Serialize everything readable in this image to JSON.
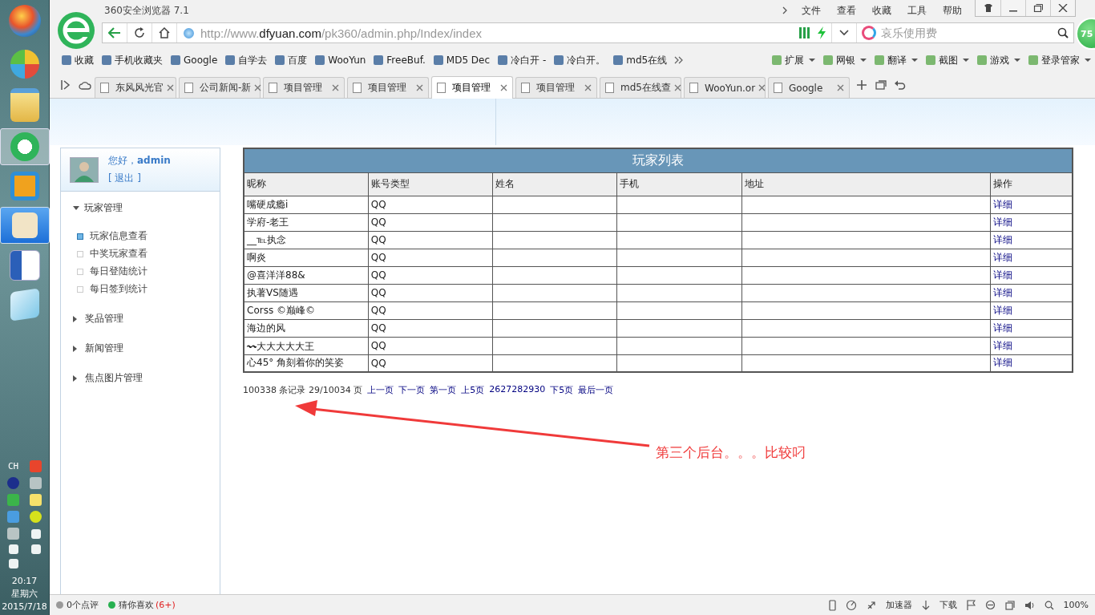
{
  "taskbar": {
    "input_method": "CH",
    "clock": {
      "time": "20:17",
      "weekday": "星期六",
      "date": "2015/7/18"
    }
  },
  "window": {
    "title": "360安全浏览器 7.1",
    "menu": [
      "文件",
      "查看",
      "收藏",
      "工具",
      "帮助"
    ],
    "speed_badge": "75"
  },
  "address_bar": {
    "url_prefix": "http://www.",
    "url_domain": "dfyuan.com",
    "url_path": "/pk360/admin.php/Index/index",
    "search_placeholder": "哀乐使用费"
  },
  "bookmarks": [
    "收藏",
    "手机收藏夹",
    "Google",
    "自学去",
    "百度",
    "WooYun",
    "FreeBuf.",
    "MD5 Dec",
    "冷白开 -",
    "冷白开。",
    "md5在线"
  ],
  "toolbar_right": [
    "扩展",
    "网银",
    "翻译",
    "截图",
    "游戏",
    "登录管家"
  ],
  "tabs": [
    {
      "label": "东风风光官",
      "selected": false
    },
    {
      "label": "公司新闻-新",
      "selected": false
    },
    {
      "label": "项目管理",
      "selected": false
    },
    {
      "label": "项目管理",
      "selected": false
    },
    {
      "label": "项目管理",
      "selected": true
    },
    {
      "label": "项目管理",
      "selected": false
    },
    {
      "label": "md5在线查",
      "selected": false
    },
    {
      "label": "WooYun.or",
      "selected": false
    },
    {
      "label": "Google",
      "selected": false
    }
  ],
  "sidebar": {
    "greeting": "您好，**admin**",
    "logout": "[ 退出 ]",
    "groups": [
      {
        "label": "玩家管理",
        "expanded": true,
        "children": [
          {
            "label": "玩家信息查看",
            "selected": true
          },
          {
            "label": "中奖玩家查看",
            "selected": false
          },
          {
            "label": "每日登陆统计",
            "selected": false
          },
          {
            "label": "每日签到统计",
            "selected": false
          }
        ]
      },
      {
        "label": "奖品管理",
        "expanded": false
      },
      {
        "label": "新闻管理",
        "expanded": false
      },
      {
        "label": "焦点图片管理",
        "expanded": false
      }
    ]
  },
  "table": {
    "title": "玩家列表",
    "columns": [
      "昵称",
      "账号类型",
      "姓名",
      "手机",
      "地址",
      "操作"
    ],
    "rows": [
      {
        "nickname": "嘴硬成瘾i",
        "account_type": "QQ",
        "action": "详细"
      },
      {
        "nickname": "学府-老王",
        "account_type": "QQ",
        "action": "详细"
      },
      {
        "nickname": "__℡执念",
        "account_type": "QQ",
        "action": "详细"
      },
      {
        "nickname": "啊炎",
        "account_type": "QQ",
        "action": "详细"
      },
      {
        "nickname": "@喜洋洋88&",
        "account_type": "QQ",
        "action": "详细"
      },
      {
        "nickname": "执著VS随遇",
        "account_type": "QQ",
        "action": "详细"
      },
      {
        "nickname": "Corss ©巅峰©",
        "account_type": "QQ",
        "action": "详细"
      },
      {
        "nickname": "海边的风",
        "account_type": "QQ",
        "action": "详细"
      },
      {
        "nickname": "〰大大大大大王",
        "account_type": "QQ",
        "action": "详细"
      },
      {
        "nickname": "心45° 角刻着你的笑姿",
        "account_type": "QQ",
        "action": "详细"
      }
    ]
  },
  "pagination": {
    "summary": "100338 条记录 29/10034 页",
    "links": [
      "上一页",
      "下一页",
      "第一页",
      "上5页",
      "2627282930",
      "下5页",
      "最后一页"
    ]
  },
  "annotation": "第三个后台。。。比较叼",
  "status_bar": {
    "reviews": "0个点评",
    "guess": "猜你喜欢",
    "guess_count": "(6+)",
    "accelerator": "加速器",
    "download": "下载",
    "zoom": "100%"
  }
}
